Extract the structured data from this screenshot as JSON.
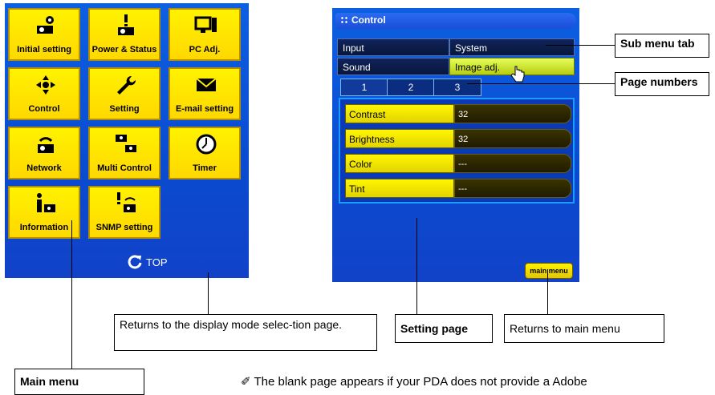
{
  "left_menu": {
    "buttons": [
      {
        "label": "Initial setting",
        "icon": "projector-gear-icon"
      },
      {
        "label": "Power & Status",
        "icon": "projector-exclamation-icon"
      },
      {
        "label": "PC Adj.",
        "icon": "monitor-icon"
      },
      {
        "label": "Control",
        "icon": "direction-arrows-icon"
      },
      {
        "label": "Setting",
        "icon": "wrench-icon"
      },
      {
        "label": "E-mail setting",
        "icon": "envelope-icon"
      },
      {
        "label": "Network",
        "icon": "projector-network-icon"
      },
      {
        "label": "Multi Control",
        "icon": "multi-projector-icon"
      },
      {
        "label": "Timer",
        "icon": "clock-icon"
      },
      {
        "label": "Information",
        "icon": "info-icon"
      },
      {
        "label": "SNMP setting",
        "icon": "snmp-icon"
      }
    ],
    "top_label": "TOP"
  },
  "control_panel": {
    "title": "Control",
    "tabs": {
      "input": "Input",
      "system": "System",
      "sound": "Sound",
      "image_adj": "Image adj."
    },
    "pages": [
      "1",
      "2",
      "3"
    ],
    "settings": [
      {
        "name": "Contrast",
        "value": "32"
      },
      {
        "name": "Brightness",
        "value": "32"
      },
      {
        "name": "Color",
        "value": "---"
      },
      {
        "name": "Tint",
        "value": "---"
      }
    ],
    "main_menu_label": "main menu"
  },
  "callouts": {
    "sub_menu_tab": "Sub menu tab",
    "page_numbers": "Page numbers",
    "returns_display": "Returns to the display mode selec-tion page.",
    "setting_page": "Setting page",
    "returns_main": "Returns to main menu",
    "main_menu": "Main menu"
  },
  "note": "✐ The blank page appears if your PDA does not provide a Adobe"
}
